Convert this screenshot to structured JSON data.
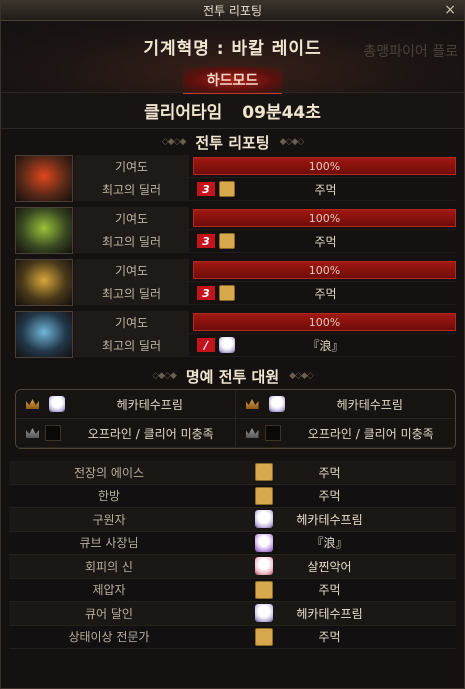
{
  "window": {
    "title": "전투 리포팅",
    "close_label": "×"
  },
  "header": {
    "raid_name": "기계혁명 : 바칼 레이드",
    "ghost_text": "총맹파이어 플로",
    "mode": "하드모드"
  },
  "clear_time": {
    "label": "클리어타임",
    "value": "09분44초"
  },
  "report": {
    "title": "전투 리포팅",
    "contribution_label": "기여도",
    "best_dealer_label": "최고의 딜러",
    "characters": [
      {
        "portrait": "red-mask-icon",
        "contribution_percent": 100,
        "contribution_text": "100%",
        "badge": "3",
        "avatar": "gold-box",
        "dealer": "주먹"
      },
      {
        "portrait": "green-mask-icon",
        "contribution_percent": 100,
        "contribution_text": "100%",
        "badge": "3",
        "avatar": "gold-box",
        "dealer": "주먹"
      },
      {
        "portrait": "gold-mask-icon",
        "contribution_percent": 100,
        "contribution_text": "100%",
        "badge": "3",
        "avatar": "gold-box",
        "dealer": "주먹"
      },
      {
        "portrait": "blue-mask-icon",
        "contribution_percent": 100,
        "contribution_text": "100%",
        "badge": "/",
        "avatar": "white-char",
        "dealer": "『浪』"
      }
    ]
  },
  "honor": {
    "title": "명예 전투 대원",
    "members": [
      {
        "name": "헤카테수프림",
        "active": true
      },
      {
        "name": "헤카테수프림",
        "active": true
      },
      {
        "name": "오프라인 / 클리어 미충족",
        "active": false
      },
      {
        "name": "오프라인 / 클리어 미충족",
        "active": false
      }
    ]
  },
  "awards": [
    {
      "title": "전장의 에이스",
      "icon": "gold-box",
      "player": "주먹"
    },
    {
      "title": "한방",
      "icon": "gold-box",
      "player": "주먹"
    },
    {
      "title": "구원자",
      "icon": "white-char",
      "player": "헤카테수프림"
    },
    {
      "title": "큐브 사장님",
      "icon": "purple-char",
      "player": "『浪』"
    },
    {
      "title": "회피의 신",
      "icon": "pink-char",
      "player": "살찐악어"
    },
    {
      "title": "제압자",
      "icon": "gold-box",
      "player": "주먹"
    },
    {
      "title": "큐어 달인",
      "icon": "white-char",
      "player": "헤카테수프림"
    },
    {
      "title": "상태이상 전문가",
      "icon": "gold-box",
      "player": "주먹"
    }
  ],
  "colors": {
    "bar_red": "#8e1210",
    "badge_red": "#c3141e",
    "gold": "#d7a94c"
  }
}
